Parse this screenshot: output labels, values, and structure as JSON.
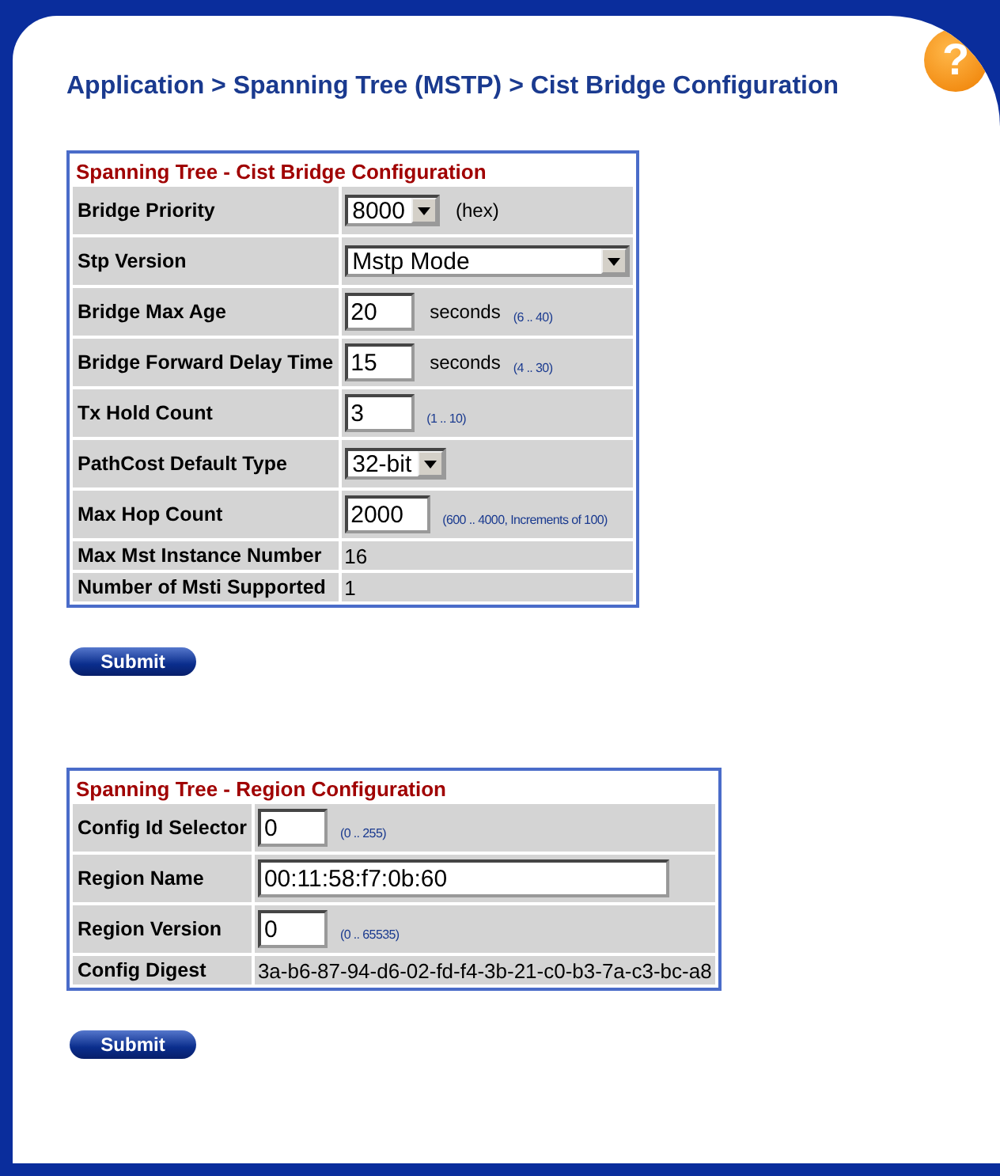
{
  "breadcrumb": "Application > Spanning Tree (MSTP) > Cist Bridge Configuration",
  "help_icon": "?",
  "sections": [
    {
      "title": "Spanning Tree - Cist Bridge Configuration",
      "submit": "Submit",
      "rows": [
        {
          "kind": "select",
          "label": "Bridge Priority",
          "value": "8000",
          "unit": "(hex)"
        },
        {
          "kind": "select",
          "label": "Stp Version",
          "value": "Mstp Mode"
        },
        {
          "kind": "input",
          "label": "Bridge Max Age",
          "value": "20",
          "unit": "seconds",
          "hint": "(6 .. 40)"
        },
        {
          "kind": "input",
          "label": "Bridge Forward Delay Time",
          "value": "15",
          "unit": "seconds",
          "hint": "(4 .. 30)"
        },
        {
          "kind": "input",
          "label": "Tx Hold Count",
          "value": "3",
          "hint": "(1 .. 10)"
        },
        {
          "kind": "select",
          "label": "PathCost Default Type",
          "value": "32-bit"
        },
        {
          "kind": "input",
          "label": "Max Hop Count",
          "value": "2000",
          "hint": "(600 .. 4000, Increments of 100)"
        },
        {
          "kind": "text",
          "label": "Max Mst Instance Number",
          "value": "16"
        },
        {
          "kind": "text",
          "label": "Number of Msti Supported",
          "value": "1"
        }
      ]
    },
    {
      "title": "Spanning Tree - Region Configuration",
      "submit": "Submit",
      "rows": [
        {
          "kind": "input",
          "label": "Config Id Selector",
          "value": "0",
          "hint": "(0 .. 255)"
        },
        {
          "kind": "input",
          "label": "Region Name",
          "value": "00:11:58:f7:0b:60"
        },
        {
          "kind": "input",
          "label": "Region Version",
          "value": "0",
          "hint": "(0 .. 65535)"
        },
        {
          "kind": "text",
          "label": "Config Digest",
          "value": "3a-b6-87-94-d6-02-fd-f4-3b-21-c0-b3-7a-c3-bc-a8"
        }
      ]
    }
  ]
}
